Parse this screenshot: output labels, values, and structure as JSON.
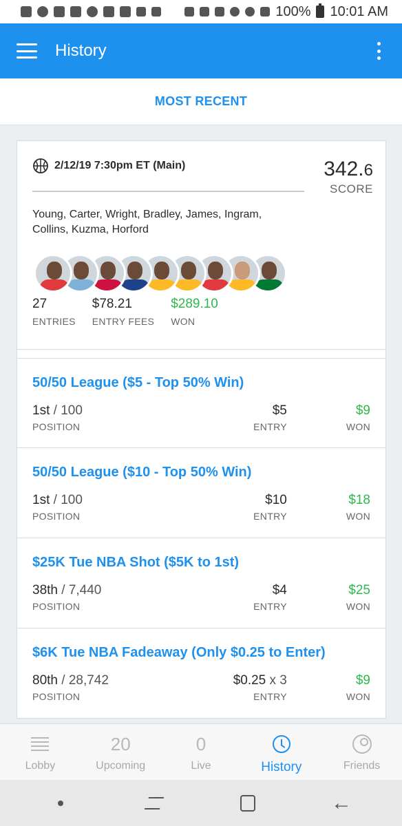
{
  "status_bar": {
    "battery": "100%",
    "time": "10:01 AM"
  },
  "app_bar": {
    "title": "History"
  },
  "filter": {
    "label": "MOST RECENT"
  },
  "summary": {
    "slate": "2/12/19 7:30pm ET (Main)",
    "score_int": "342.",
    "score_dec": "6",
    "score_label": "SCORE",
    "lineup": "Young, Carter, Wright, Bradley, James, Ingram, Collins, Kuzma, Horford",
    "players": [
      {
        "name": "Young",
        "jersey": "#e03a3e"
      },
      {
        "name": "Carter",
        "jersey": "#7fb0d8"
      },
      {
        "name": "Wright",
        "jersey": "#ce1141"
      },
      {
        "name": "Bradley",
        "jersey": "#1d428a"
      },
      {
        "name": "James",
        "jersey": "#fdb927"
      },
      {
        "name": "Ingram",
        "jersey": "#fdb927"
      },
      {
        "name": "Collins",
        "jersey": "#e03a3e"
      },
      {
        "name": "Kuzma",
        "jersey": "#fdb927"
      },
      {
        "name": "Horford",
        "jersey": "#007a33"
      }
    ],
    "stats": [
      {
        "value": "27",
        "label": "ENTRIES",
        "green": false
      },
      {
        "value": "$78.21",
        "label": "ENTRY FEES",
        "green": false
      },
      {
        "value": "$289.10",
        "label": "WON",
        "green": true
      }
    ]
  },
  "contests": [
    {
      "name": "50/50 League ($5 - Top 50% Win)",
      "place": "1st",
      "of": " / 100",
      "position_label": "POSITION",
      "entry": "$5",
      "entry_mult": "",
      "entry_label": "ENTRY",
      "won": "$9",
      "won_label": "WON"
    },
    {
      "name": "50/50 League ($10 - Top 50% Win)",
      "place": "1st",
      "of": " / 100",
      "position_label": "POSITION",
      "entry": "$10",
      "entry_mult": "",
      "entry_label": "ENTRY",
      "won": "$18",
      "won_label": "WON"
    },
    {
      "name": "$25K Tue NBA Shot ($5K to 1st)",
      "place": "38th",
      "of": " / 7,440",
      "position_label": "POSITION",
      "entry": "$4",
      "entry_mult": "",
      "entry_label": "ENTRY",
      "won": "$25",
      "won_label": "WON"
    },
    {
      "name": "$6K Tue NBA Fadeaway (Only $0.25 to Enter)",
      "place": "80th",
      "of": " / 28,742",
      "position_label": "POSITION",
      "entry": "$0.25",
      "entry_mult": " x 3",
      "entry_label": "ENTRY",
      "won": "$9",
      "won_label": "WON"
    }
  ],
  "bottom_nav": {
    "lobby": "Lobby",
    "upcoming_count": "20",
    "upcoming": "Upcoming",
    "live_count": "0",
    "live": "Live",
    "history": "History",
    "friends": "Friends"
  },
  "colors": {
    "accent": "#1e90ee",
    "won_green": "#2db84d"
  }
}
